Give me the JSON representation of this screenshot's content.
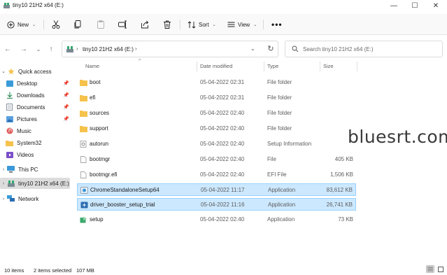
{
  "window": {
    "title": "tiny10 21H2 x64 (E:)",
    "controls": {
      "minimize": "—",
      "maximize": "☐",
      "close": "✕"
    }
  },
  "toolbar": {
    "new_label": "New",
    "sort_label": "Sort",
    "view_label": "View",
    "more_label": "•••",
    "icons": [
      "cut-icon",
      "copy-icon",
      "paste-icon",
      "rename-icon",
      "share-icon",
      "delete-icon"
    ]
  },
  "address": {
    "path": "tiny10 21H2 x64 (E:)",
    "search_placeholder": "Search tiny10 21H2 x64 (E:)"
  },
  "sidebar": {
    "items": [
      {
        "label": "Quick access",
        "icon": "star-icon"
      },
      {
        "label": "Desktop",
        "icon": "desktop-icon",
        "pinned": true
      },
      {
        "label": "Downloads",
        "icon": "download-icon",
        "pinned": true
      },
      {
        "label": "Documents",
        "icon": "documents-icon",
        "pinned": true
      },
      {
        "label": "Pictures",
        "icon": "pictures-icon",
        "pinned": true
      },
      {
        "label": "Music",
        "icon": "music-icon"
      },
      {
        "label": "System32",
        "icon": "folder-icon"
      },
      {
        "label": "Videos",
        "icon": "videos-icon"
      },
      {
        "label": "This PC",
        "icon": "pc-icon"
      },
      {
        "label": "tiny10 21H2 x64 (E:)",
        "icon": "drive-icon",
        "selected": true
      },
      {
        "label": "Network",
        "icon": "network-icon"
      }
    ]
  },
  "columns": {
    "name": "Name",
    "date": "Date modified",
    "type": "Type",
    "size": "Size"
  },
  "files": [
    {
      "name": "boot",
      "date": "05-04-2022 02:31",
      "type": "File folder",
      "size": "",
      "icon": "folder-icon"
    },
    {
      "name": "efi",
      "date": "05-04-2022 02:31",
      "type": "File folder",
      "size": "",
      "icon": "folder-icon"
    },
    {
      "name": "sources",
      "date": "05-04-2022 02:40",
      "type": "File folder",
      "size": "",
      "icon": "folder-icon"
    },
    {
      "name": "support",
      "date": "05-04-2022 02:40",
      "type": "File folder",
      "size": "",
      "icon": "folder-icon"
    },
    {
      "name": "autorun",
      "date": "05-04-2022 02:40",
      "type": "Setup Information",
      "size": "",
      "icon": "settings-file-icon"
    },
    {
      "name": "bootmgr",
      "date": "05-04-2022 02:40",
      "type": "File",
      "size": "405 KB",
      "icon": "file-icon"
    },
    {
      "name": "bootmgr.efi",
      "date": "05-04-2022 02:40",
      "type": "EFI File",
      "size": "1,506 KB",
      "icon": "file-icon"
    },
    {
      "name": "ChromeStandaloneSetup64",
      "date": "05-04-2022 11:17",
      "type": "Application",
      "size": "83,612 KB",
      "icon": "app-icon",
      "selected": true
    },
    {
      "name": "driver_booster_setup_trial",
      "date": "05-04-2022 11:16",
      "type": "Application",
      "size": "26,741 KB",
      "icon": "app-icon",
      "selected": true
    },
    {
      "name": "setup",
      "date": "05-04-2022 02:40",
      "type": "Application",
      "size": "73 KB",
      "icon": "setup-icon"
    }
  ],
  "watermark": "bluesrt.com",
  "status": {
    "items": "10 items",
    "selected": "2 items selected",
    "size": "107 MB"
  },
  "colors": {
    "selection": "#cce8ff",
    "selection_border": "#99d1ff",
    "folder": "#f5c24c",
    "accent": "#0067c0"
  }
}
